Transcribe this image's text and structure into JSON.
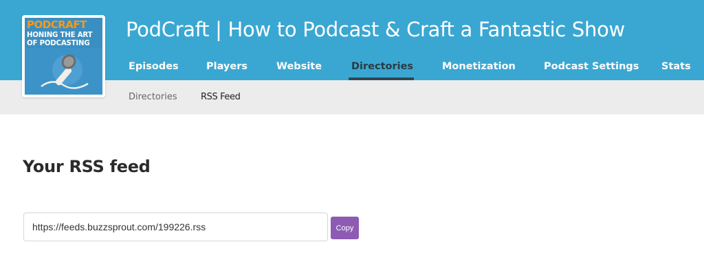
{
  "podcast": {
    "title": "PodCraft | How to Podcast & Craft a Fantastic Show",
    "artwork": {
      "line1": "PODCRAFT",
      "line2": "HONING THE ART",
      "line3": "OF PODCASTING",
      "icon": "microphone-icon"
    }
  },
  "nav": {
    "tabs": [
      {
        "label": "Episodes"
      },
      {
        "label": "Players"
      },
      {
        "label": "Website"
      },
      {
        "label": "Directories",
        "active": true
      },
      {
        "label": "Monetization"
      },
      {
        "label": "Podcast Settings"
      },
      {
        "label": "Stats"
      }
    ]
  },
  "subnav": {
    "tabs": [
      {
        "label": "Directories"
      },
      {
        "label": "RSS Feed",
        "active": true
      }
    ]
  },
  "rss": {
    "heading": "Your RSS feed",
    "url": "https://feeds.buzzsprout.com/199226.rss",
    "copy_label": "Copy"
  },
  "colors": {
    "header_blue": "#3aa7d2",
    "subnav_gray": "#ececec",
    "active_tab_text": "#2a3b44",
    "copy_button": "#8e5bb4",
    "logo_orange": "#f39a1e"
  }
}
